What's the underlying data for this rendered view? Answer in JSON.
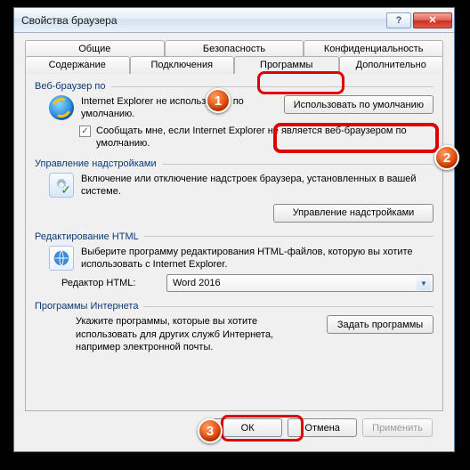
{
  "window": {
    "title": "Свойства браузера"
  },
  "tabs_row1": [
    {
      "label": "Общие"
    },
    {
      "label": "Безопасность"
    },
    {
      "label": "Конфиденциальность"
    }
  ],
  "tabs_row2": [
    {
      "label": "Содержание"
    },
    {
      "label": "Подключения"
    },
    {
      "label": "Программы"
    },
    {
      "label": "Дополнительно"
    }
  ],
  "browser_section": {
    "title": "Веб-браузер по",
    "status": "Internet Explorer не используется по умолчанию.",
    "use_default_btn": "Использовать по умолчанию",
    "notify_checkbox_checked": "✓",
    "notify_label": "Сообщать мне, если Internet Explorer не является веб-браузером по умолчанию."
  },
  "addons_section": {
    "title": "Управление надстройками",
    "desc": "Включение или отключение надстроек браузера, установленных в вашей системе.",
    "manage_btn": "Управление надстройками"
  },
  "html_section": {
    "title": "Редактирование HTML",
    "desc": "Выберите программу редактирования HTML-файлов, которую вы хотите использовать с Internet Explorer.",
    "editor_label": "Редактор HTML:",
    "editor_value": "Word 2016"
  },
  "internet_section": {
    "title": "Программы Интернета",
    "desc": "Укажите программы, которые вы хотите использовать для других служб Интернета, например электронной почты.",
    "set_btn": "Задать программы"
  },
  "buttons": {
    "ok": "ОК",
    "cancel": "Отмена",
    "apply": "Применить"
  },
  "callouts": {
    "1": "1",
    "2": "2",
    "3": "3"
  }
}
